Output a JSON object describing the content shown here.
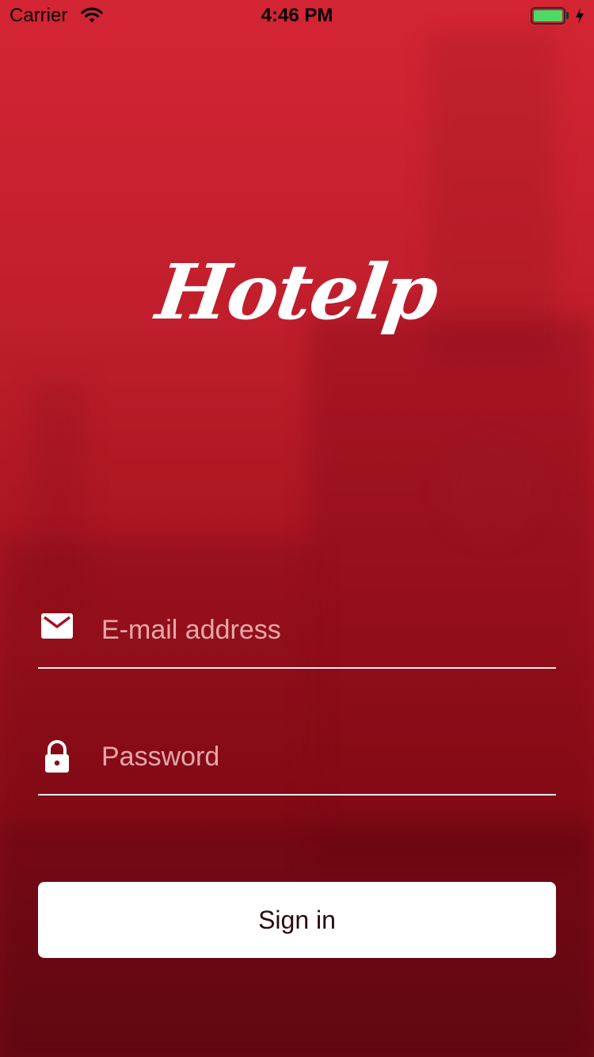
{
  "status_bar": {
    "carrier": "Carrier",
    "time": "4:46 PM",
    "wifi_icon": "wifi-icon",
    "battery_icon": "battery-full-icon",
    "charging_icon": "bolt-icon"
  },
  "logo": {
    "text": "Hotelp"
  },
  "form": {
    "email": {
      "icon": "envelope-icon",
      "placeholder": "E-mail address",
      "value": ""
    },
    "password": {
      "icon": "lock-icon",
      "placeholder": "Password",
      "value": ""
    },
    "sign_in_label": "Sign in"
  },
  "colors": {
    "background_top": "#d42534",
    "background_bottom": "#6e0a14",
    "battery_fill": "#4cd964",
    "button_bg": "#ffffff",
    "button_text": "#2a0a0e"
  }
}
